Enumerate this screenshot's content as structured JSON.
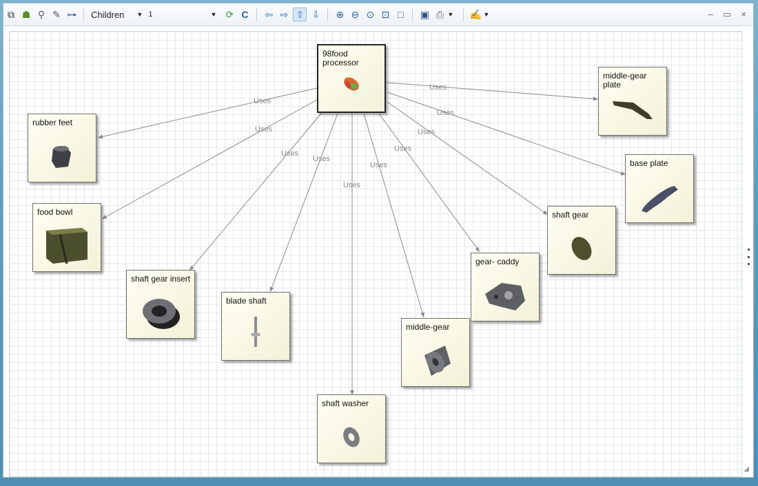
{
  "toolbar": {
    "filter": {
      "value": "Children",
      "level": "1"
    },
    "window_controls": {
      "minimize": "–",
      "maximize": "▭",
      "close": "×"
    }
  },
  "colors": {
    "edge": "#8a8a8a",
    "node_fill": "#f7f5df",
    "canvas_grid": "#e4e7ea"
  },
  "edge_label": "Uses",
  "root": {
    "label": "98food processor",
    "icon": "food-processor-icon"
  },
  "nodes": [
    {
      "id": "rubber-feet",
      "label": "rubber feet",
      "icon": "rubber-foot-icon"
    },
    {
      "id": "food-bowl",
      "label": "food bowl",
      "icon": "bowl-icon"
    },
    {
      "id": "shaft-gear-insert",
      "label": "shaft gear insert",
      "icon": "gear-insert-icon"
    },
    {
      "id": "blade-shaft",
      "label": "blade shaft",
      "icon": "blade-shaft-icon"
    },
    {
      "id": "shaft-washer",
      "label": "shaft washer",
      "icon": "washer-icon"
    },
    {
      "id": "middle-gear",
      "label": "middle-gear",
      "icon": "middle-gear-icon"
    },
    {
      "id": "gear-caddy",
      "label": "gear- caddy",
      "icon": "gear-caddy-icon"
    },
    {
      "id": "shaft-gear",
      "label": "shaft gear",
      "icon": "shaft-gear-icon"
    },
    {
      "id": "base-plate",
      "label": "base plate",
      "icon": "base-plate-icon"
    },
    {
      "id": "middle-gear-plate",
      "label": "middle-gear plate",
      "icon": "gear-plate-icon"
    }
  ]
}
